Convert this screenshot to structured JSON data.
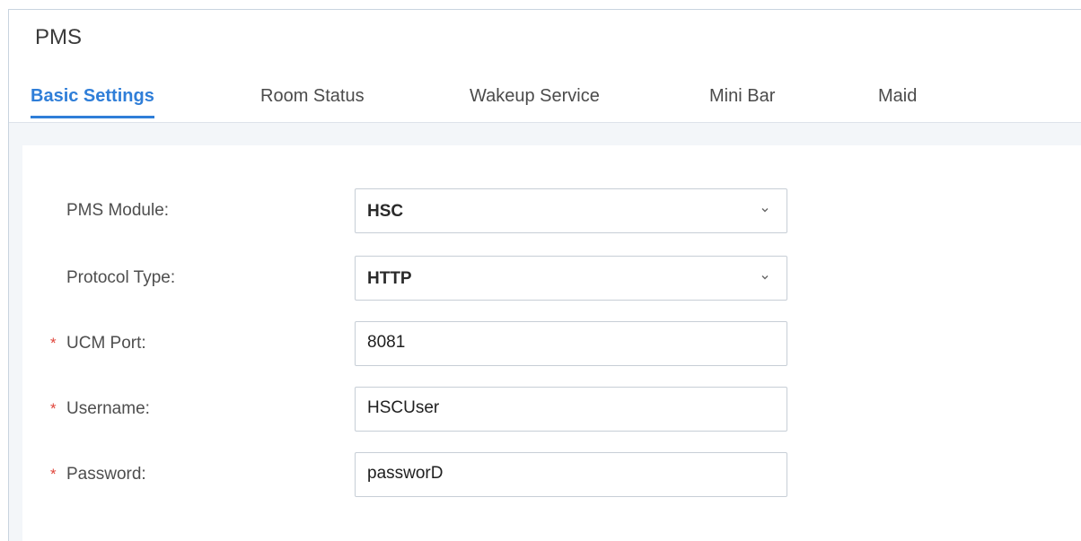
{
  "page": {
    "title": "PMS"
  },
  "tabs": [
    {
      "label": "Basic Settings",
      "active": true
    },
    {
      "label": "Room Status",
      "active": false
    },
    {
      "label": "Wakeup Service",
      "active": false
    },
    {
      "label": "Mini Bar",
      "active": false
    },
    {
      "label": "Maid",
      "active": false
    }
  ],
  "form": {
    "pms_module": {
      "label": "PMS Module:",
      "value": "HSC",
      "required": false
    },
    "protocol_type": {
      "label": "Protocol Type:",
      "value": "HTTP",
      "required": false
    },
    "ucm_port": {
      "label": "UCM Port:",
      "value": "8081",
      "required": true
    },
    "username": {
      "label": "Username:",
      "value": "HSCUser",
      "required": true
    },
    "password": {
      "label": "Password:",
      "value": "passworD",
      "required": true
    },
    "required_marker": "*"
  },
  "colors": {
    "accent": "#2f7ed8",
    "required": "#e0453b",
    "content_background": "#f3f6f9"
  }
}
